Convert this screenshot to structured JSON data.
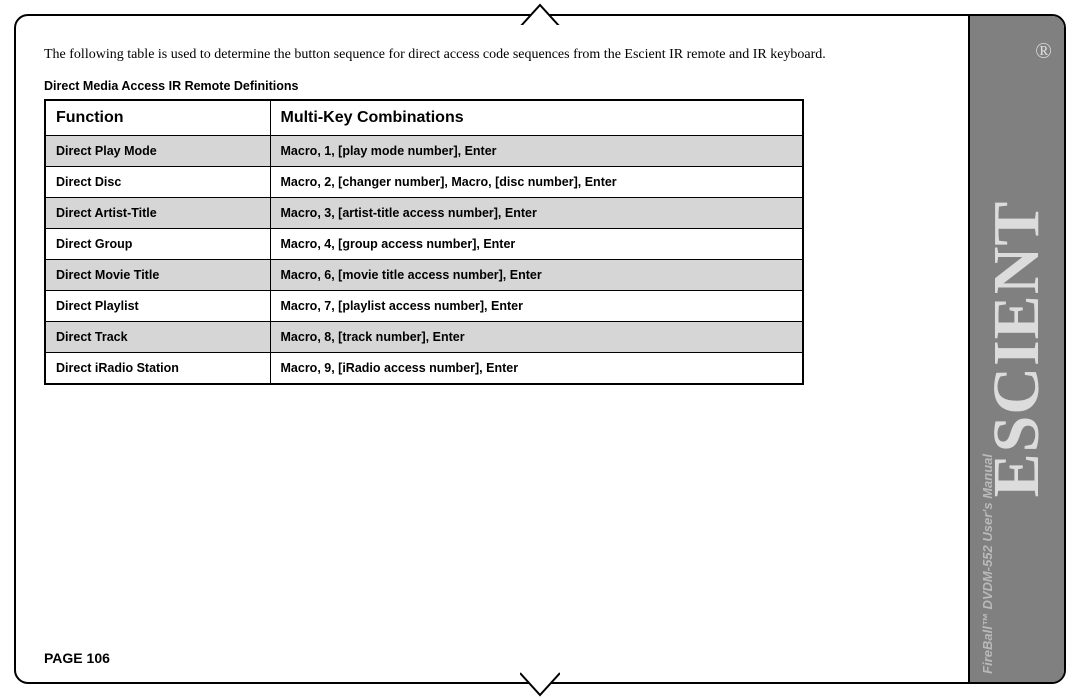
{
  "intro": "The following table is used to determine the button sequence for direct access code sequences from the Escient IR remote and IR keyboard.",
  "tableTitle": "Direct Media Access IR Remote Definitions",
  "headers": {
    "function": "Function",
    "combo": "Multi-Key Combinations"
  },
  "rows": [
    {
      "function": "Direct Play Mode",
      "combo": "Macro, 1, [play mode number], Enter",
      "shaded": true
    },
    {
      "function": "Direct Disc",
      "combo": "Macro, 2, [changer number], Macro, [disc number], Enter",
      "shaded": false
    },
    {
      "function": "Direct Artist-Title",
      "combo": "Macro, 3, [artist-title access number], Enter",
      "shaded": true
    },
    {
      "function": "Direct Group",
      "combo": "Macro, 4, [group access number], Enter",
      "shaded": false
    },
    {
      "function": "Direct Movie Title",
      "combo": "Macro, 6, [movie title access number], Enter",
      "shaded": true
    },
    {
      "function": "Direct Playlist",
      "combo": "Macro, 7, [playlist access number], Enter",
      "shaded": false
    },
    {
      "function": "Direct Track",
      "combo": "Macro, 8, [track number], Enter",
      "shaded": true
    },
    {
      "function": "Direct iRadio Station",
      "combo": "Macro, 9, [iRadio access number], Enter",
      "shaded": false
    }
  ],
  "pageLabel": "PAGE 106",
  "brand": "ESCIENT",
  "registered": "®",
  "manualLine": "FireBall™ DVDM-552 User's Manual"
}
